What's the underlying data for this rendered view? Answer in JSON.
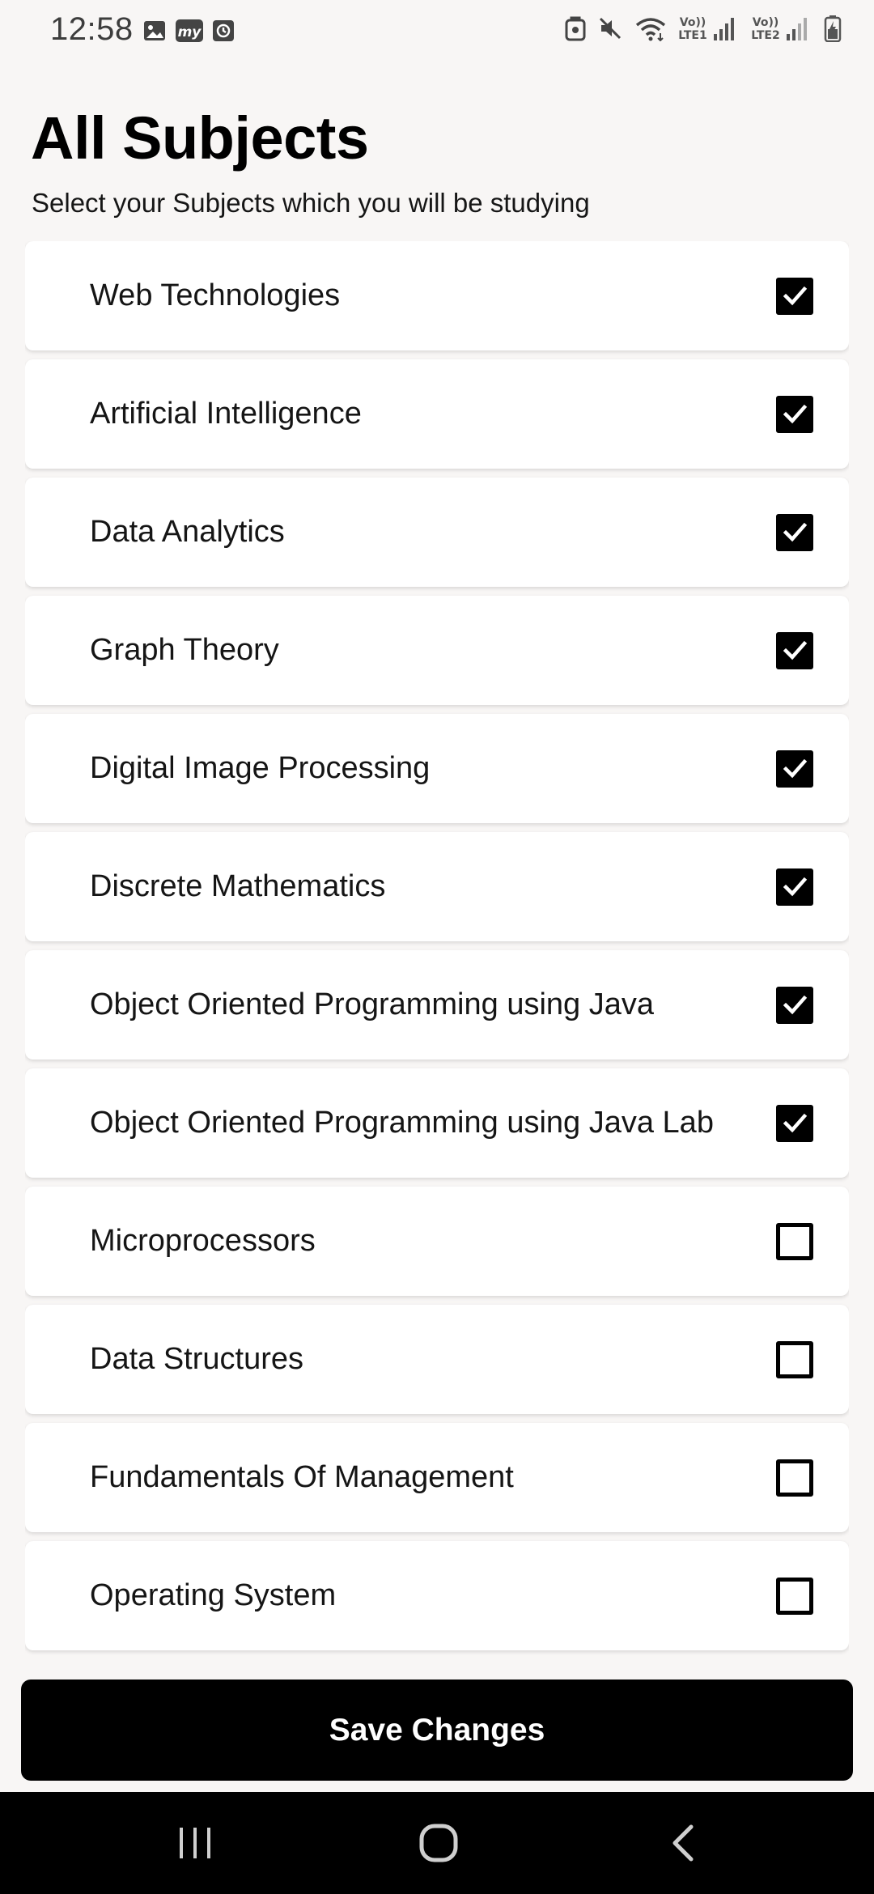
{
  "status_bar": {
    "time": "12:58",
    "left_icons": [
      "image-icon",
      "my-app-icon",
      "clock-app-icon"
    ],
    "right_icons": [
      "nfc-icon",
      "mute-icon",
      "wifi-icon",
      "signal-lte1-icon",
      "signal-lte2-icon",
      "battery-icon"
    ],
    "network_1": "Vo)) LTE1",
    "network_2": "Vo)) LTE2"
  },
  "header": {
    "title": "All Subjects",
    "subtitle": "Select your Subjects which you will be studying"
  },
  "subjects": [
    {
      "label": "Web Technologies",
      "checked": true
    },
    {
      "label": "Artificial Intelligence",
      "checked": true
    },
    {
      "label": "Data Analytics",
      "checked": true
    },
    {
      "label": "Graph Theory",
      "checked": true
    },
    {
      "label": "Digital Image Processing",
      "checked": true
    },
    {
      "label": "Discrete Mathematics",
      "checked": true
    },
    {
      "label": "Object Oriented Programming using Java",
      "checked": true
    },
    {
      "label": "Object Oriented Programming using Java Lab",
      "checked": true
    },
    {
      "label": "Microprocessors",
      "checked": false
    },
    {
      "label": "Data Structures",
      "checked": false
    },
    {
      "label": "Fundamentals Of Management",
      "checked": false
    },
    {
      "label": "Operating System",
      "checked": false
    }
  ],
  "footer": {
    "save_label": "Save Changes"
  },
  "nav_bar": {
    "buttons": [
      "recents-icon",
      "home-icon",
      "back-icon"
    ]
  }
}
